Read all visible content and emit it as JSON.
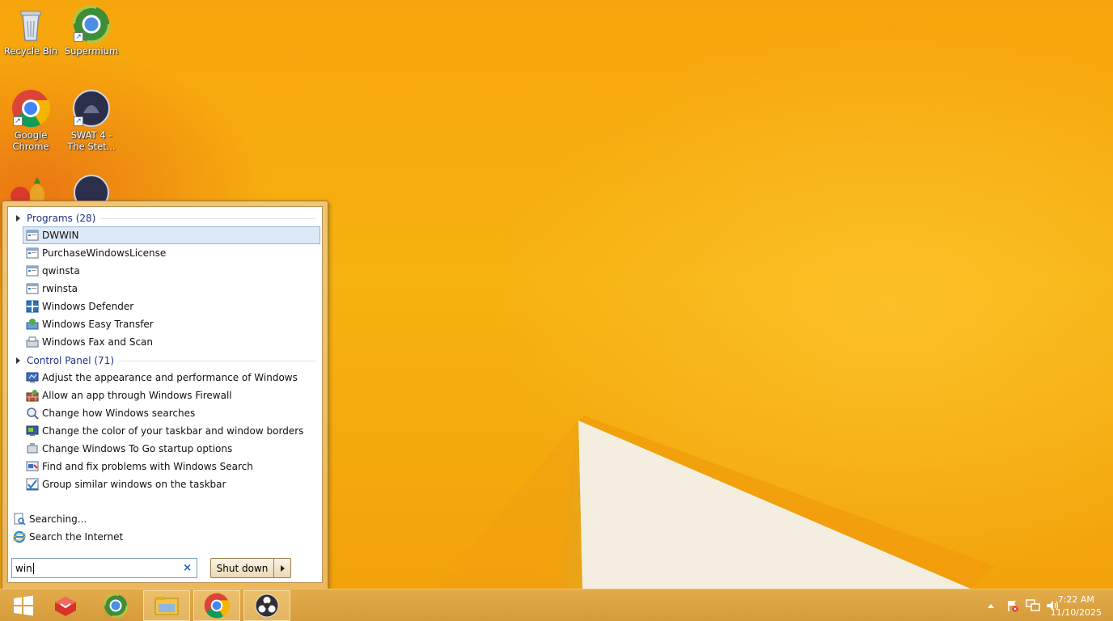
{
  "desktop": {
    "icons": [
      {
        "label": "Recycle Bin"
      },
      {
        "label": "Supermium"
      },
      {
        "label": "Google Chrome"
      },
      {
        "label": "SWAT 4 - The Stet..."
      }
    ]
  },
  "start_menu": {
    "groups": [
      {
        "title": "Programs (28)",
        "items": [
          "DWWIN",
          "PurchaseWindowsLicense",
          "qwinsta",
          "rwinsta",
          "Windows Defender",
          "Windows Easy Transfer",
          "Windows Fax and Scan"
        ]
      },
      {
        "title": "Control Panel (71)",
        "items": [
          "Adjust the appearance and performance of Windows",
          "Allow an app through Windows Firewall",
          "Change how Windows searches",
          "Change the color of your taskbar and window borders",
          "Change Windows To Go startup options",
          "Find and fix problems with Windows Search",
          "Group similar windows on the taskbar"
        ]
      }
    ],
    "searching_label": "Searching...",
    "search_internet_label": "Search the Internet",
    "search_value": "win",
    "clear_glyph": "×",
    "shutdown_label": "Shut down"
  },
  "taskbar": {
    "apps": [
      "Start",
      "TeamViewer-like app",
      "Supermium",
      "File Explorer",
      "Google Chrome",
      "OBS Studio"
    ],
    "clock": {
      "time": "7:22 AM",
      "date": "11/10/2025"
    }
  },
  "colors": {
    "accent": "#f6b20f",
    "group_header": "#1e3287",
    "selection": "#dce9f7"
  }
}
